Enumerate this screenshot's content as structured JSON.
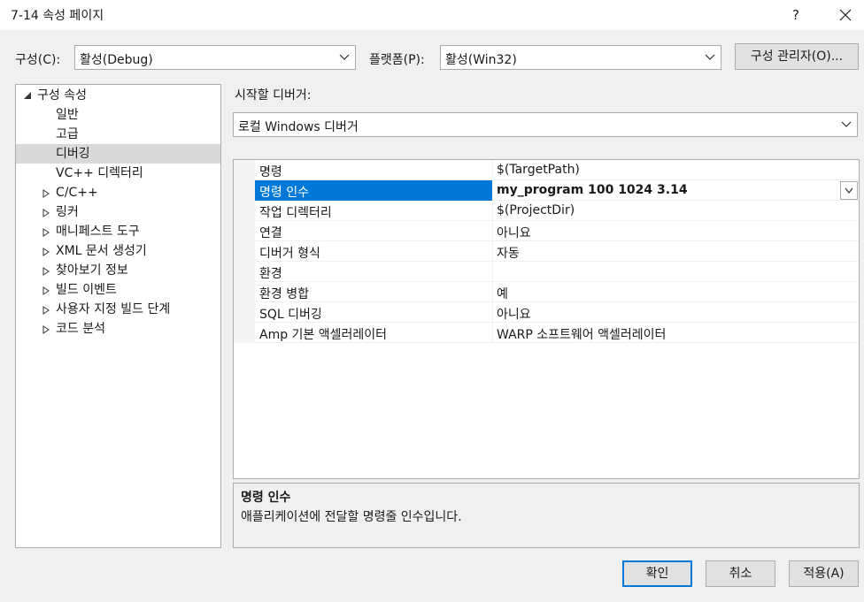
{
  "window": {
    "title": "7-14 속성 페이지",
    "help_label": "?"
  },
  "toolbar": {
    "config_label": "구성(C):",
    "config_value": "활성(Debug)",
    "platform_label": "플랫폼(P):",
    "platform_value": "활성(Win32)",
    "config_manager_label": "구성 관리자(O)..."
  },
  "tree": {
    "root": "구성 속성",
    "items": [
      {
        "label": "일반"
      },
      {
        "label": "고급"
      },
      {
        "label": "디버깅",
        "selected": true
      },
      {
        "label": "VC++ 디렉터리"
      },
      {
        "label": "C/C++",
        "expandable": true
      },
      {
        "label": "링커",
        "expandable": true
      },
      {
        "label": "매니페스트 도구",
        "expandable": true
      },
      {
        "label": "XML 문서 생성기",
        "expandable": true
      },
      {
        "label": "찾아보기 정보",
        "expandable": true
      },
      {
        "label": "빌드 이벤트",
        "expandable": true
      },
      {
        "label": "사용자 지정 빌드 단계",
        "expandable": true
      },
      {
        "label": "코드 분석",
        "expandable": true
      }
    ]
  },
  "debugger": {
    "label": "시작할 디버거:",
    "value": "로컬 Windows 디버거"
  },
  "properties": [
    {
      "name": "명령",
      "value": "$(TargetPath)"
    },
    {
      "name": "명령 인수",
      "value": "my_program 100 1024 3.14",
      "active": true
    },
    {
      "name": "작업 디렉터리",
      "value": "$(ProjectDir)"
    },
    {
      "name": "연결",
      "value": "아니요"
    },
    {
      "name": "디버거 형식",
      "value": "자동"
    },
    {
      "name": "환경",
      "value": ""
    },
    {
      "name": "환경 병합",
      "value": "예"
    },
    {
      "name": "SQL 디버깅",
      "value": "아니요"
    },
    {
      "name": "Amp 기본 액셀러레이터",
      "value": "WARP 소프트웨어 액셀러레이터"
    }
  ],
  "description": {
    "title": "명령 인수",
    "text": "애플리케이션에 전달할 명령줄 인수입니다."
  },
  "buttons": {
    "ok": "확인",
    "cancel": "취소",
    "apply": "적용(A)"
  },
  "colors": {
    "accent": "#0078d7",
    "selection": "#d9d9d9"
  }
}
